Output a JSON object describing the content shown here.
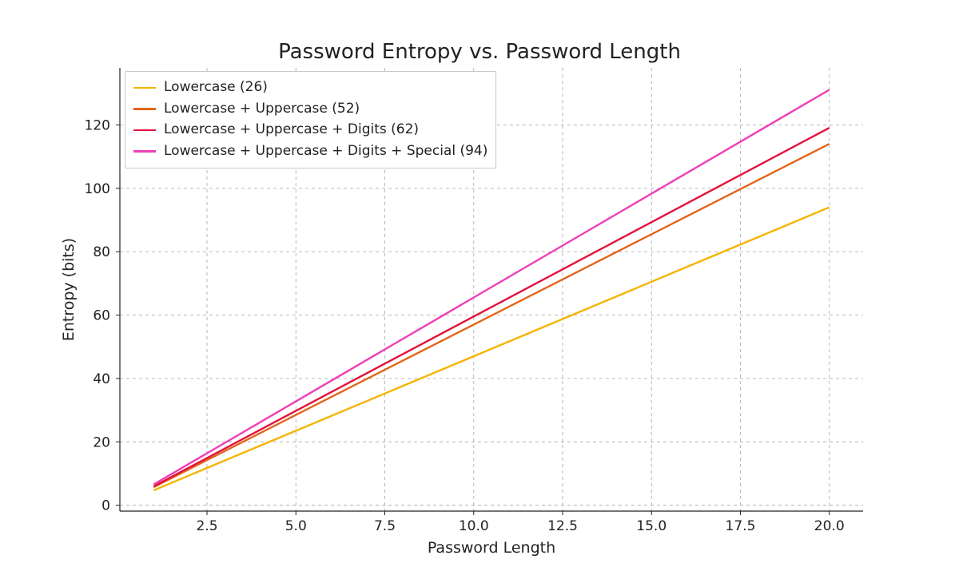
{
  "chart_data": {
    "type": "line",
    "title": "Password Entropy vs. Password Length",
    "xlabel": "Password Length",
    "ylabel": "Entropy (bits)",
    "xlim": [
      0.05,
      20.95
    ],
    "ylim": [
      -1.86,
      138
    ],
    "xticks": [
      2.5,
      5.0,
      7.5,
      10.0,
      12.5,
      15.0,
      17.5,
      20.0
    ],
    "yticks": [
      0,
      20,
      40,
      60,
      80,
      100,
      120
    ],
    "x": [
      1,
      2,
      3,
      4,
      5,
      6,
      7,
      8,
      9,
      10,
      11,
      12,
      13,
      14,
      15,
      16,
      17,
      18,
      19,
      20
    ],
    "series": [
      {
        "name": "Lowercase (26)",
        "color": "#f5b400",
        "values": [
          4.7,
          9.4,
          14.1,
          18.8,
          23.5,
          28.2,
          32.9,
          37.6,
          42.3,
          47.0,
          51.7,
          56.41,
          61.11,
          65.81,
          70.51,
          75.21,
          79.91,
          84.61,
          89.31,
          94.01
        ]
      },
      {
        "name": "Lowercase + Uppercase (52)",
        "color": "#e3651b",
        "values": [
          5.7,
          11.4,
          17.1,
          22.8,
          28.5,
          34.2,
          39.9,
          45.6,
          51.3,
          57.0,
          62.7,
          68.41,
          74.11,
          79.81,
          85.51,
          91.21,
          96.91,
          102.61,
          108.31,
          114.01
        ]
      },
      {
        "name": "Lowercase + Uppercase + Digits (62)",
        "color": "#e3123d",
        "values": [
          5.95,
          11.91,
          17.86,
          23.82,
          29.77,
          35.73,
          41.68,
          47.63,
          53.59,
          59.54,
          65.5,
          71.45,
          77.4,
          83.36,
          89.31,
          95.27,
          101.22,
          107.17,
          113.13,
          119.08
        ]
      },
      {
        "name": "Lowercase + Uppercase + Digits + Special (94)",
        "color": "#ef3fb6",
        "values": [
          6.55,
          13.11,
          19.66,
          26.22,
          32.77,
          39.33,
          45.88,
          52.44,
          58.99,
          65.55,
          72.1,
          78.66,
          85.21,
          91.76,
          98.32,
          104.87,
          111.43,
          117.98,
          124.54,
          131.09
        ]
      }
    ],
    "legend_position": "upper left",
    "grid": true
  }
}
